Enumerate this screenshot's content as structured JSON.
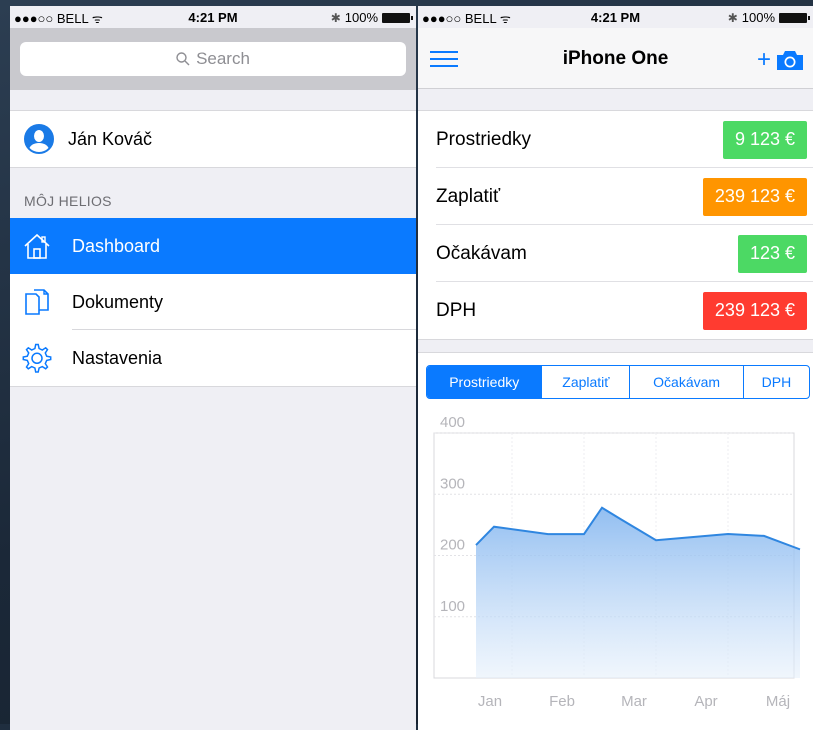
{
  "status_bar": {
    "carrier": "●●●○○ BELL",
    "time": "4:21 PM",
    "battery": "100%"
  },
  "left": {
    "search": {
      "placeholder": "Search"
    },
    "profile": {
      "name": "Ján Kováč"
    },
    "section_header": "MÔJ HELIOS",
    "menu": [
      {
        "label": "Dashboard",
        "icon": "home-icon",
        "active": true
      },
      {
        "label": "Dokumenty",
        "icon": "documents-icon",
        "active": false
      },
      {
        "label": "Nastavenia",
        "icon": "gear-icon",
        "active": false
      }
    ]
  },
  "right": {
    "nav_title": "iPhone One",
    "nav_add": "+",
    "summary": [
      {
        "label": "Prostriedky",
        "value": "9 123 €",
        "color": "#4cd964"
      },
      {
        "label": "Zaplatiť",
        "value": "239 123 €",
        "color": "#ff9500"
      },
      {
        "label": "Očakávam",
        "value": "123 €",
        "color": "#4cd964"
      },
      {
        "label": "DPH",
        "value": "239 123 €",
        "color": "#ff3b30"
      }
    ],
    "tabs": [
      "Prostriedky",
      "Zaplatiť",
      "Očakávam",
      "DPH"
    ],
    "active_tab": 0
  },
  "colors": {
    "accent": "#0a7aff"
  },
  "chart_data": {
    "type": "area",
    "categories": [
      "Jan",
      "Feb",
      "Mar",
      "Apr",
      "Máj"
    ],
    "x": [
      0,
      0.25,
      1,
      1.5,
      1.75,
      2,
      2.5,
      3,
      3.5,
      4,
      4.5
    ],
    "y": [
      217,
      247,
      235,
      235,
      278,
      260,
      225,
      230,
      235,
      232,
      210
    ],
    "yticks": [
      100,
      200,
      300,
      400
    ],
    "ylim": [
      0,
      400
    ],
    "grid": true
  }
}
